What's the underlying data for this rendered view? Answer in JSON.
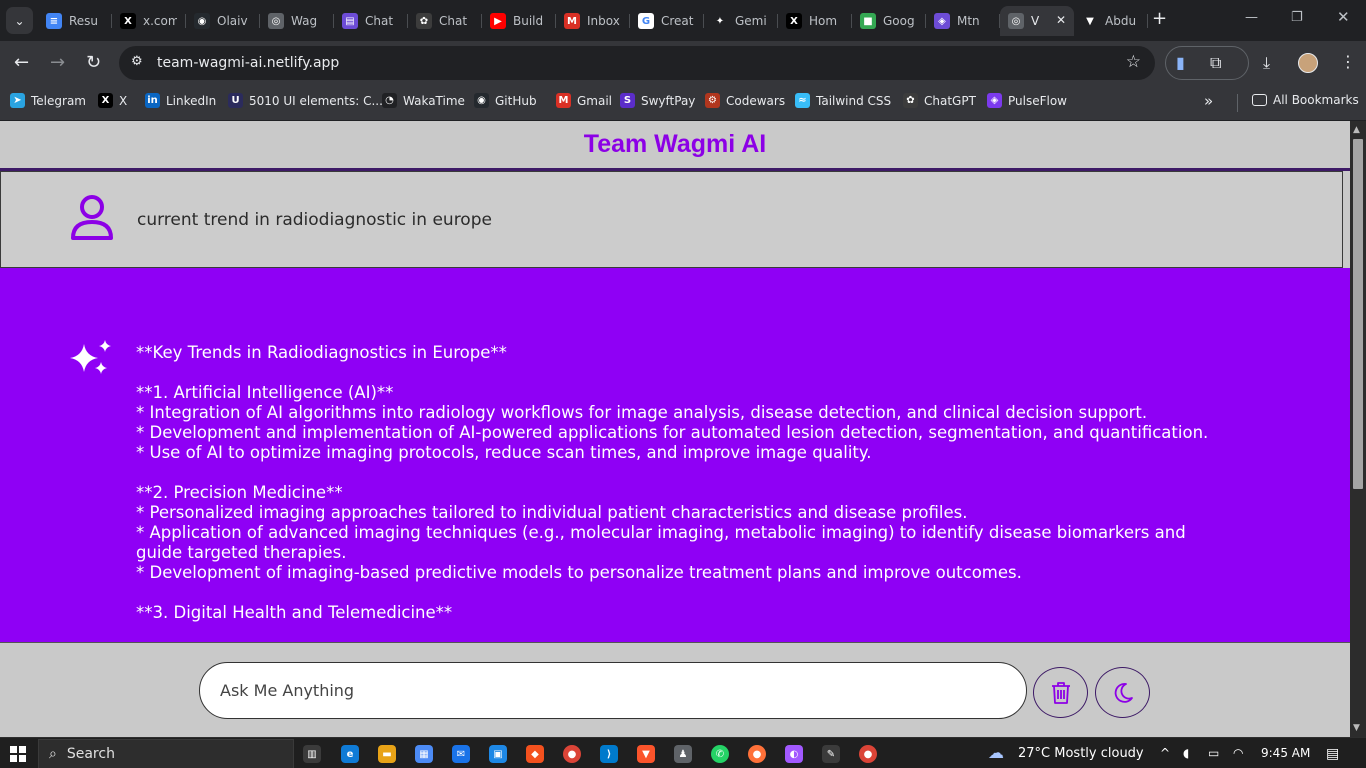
{
  "browser": {
    "tabs": [
      {
        "label": "Resu",
        "icon": "docs-icon",
        "color": "#4285f4",
        "glyph": "≡"
      },
      {
        "label": "x.com",
        "icon": "x-icon",
        "color": "#000000",
        "glyph": "X"
      },
      {
        "label": "Olaiv",
        "icon": "github-icon",
        "color": "#24292e",
        "glyph": "◉"
      },
      {
        "label": "Wag",
        "icon": "globe-icon",
        "color": "#5f6368",
        "glyph": "◎"
      },
      {
        "label": "Chat",
        "icon": "app-icon",
        "color": "#6d4cd6",
        "glyph": "▤"
      },
      {
        "label": "Chat",
        "icon": "chatgpt-icon",
        "color": "#3c3c3c",
        "glyph": "✿"
      },
      {
        "label": "Build",
        "icon": "youtube-icon",
        "color": "#ff0000",
        "glyph": "▶"
      },
      {
        "label": "Inbox",
        "icon": "gmail-icon",
        "color": "#d93025",
        "glyph": "M"
      },
      {
        "label": "Creat",
        "icon": "google-icon",
        "color": "#ffffff",
        "glyph": "G"
      },
      {
        "label": "Gemi",
        "icon": "gemini-icon",
        "color": "#202124",
        "glyph": "✦"
      },
      {
        "label": "Hom",
        "icon": "x-icon",
        "color": "#000000",
        "glyph": "X"
      },
      {
        "label": "Goog",
        "icon": "meet-icon",
        "color": "#34a853",
        "glyph": "■"
      },
      {
        "label": "Mtn",
        "icon": "app-icon",
        "color": "#6d4cd6",
        "glyph": "◈"
      },
      {
        "label": "V",
        "icon": "globe-icon",
        "color": "#5f6368",
        "glyph": "◎",
        "active": true
      },
      {
        "label": "Abdu",
        "icon": "vite-icon",
        "color": "#202124",
        "glyph": "▼"
      }
    ],
    "url": "team-wagmi-ai.netlify.app",
    "bookmarks": [
      {
        "label": "Telegram",
        "icon": "telegram-icon",
        "color": "#2aa3e0",
        "glyph": "➤"
      },
      {
        "label": "X",
        "icon": "x-icon",
        "color": "#000000",
        "glyph": "X"
      },
      {
        "label": "LinkedIn",
        "icon": "linkedin-icon",
        "color": "#0a66c2",
        "glyph": "in"
      },
      {
        "label": "5010 UI elements: C...",
        "icon": "uiverse-icon",
        "color": "#2b2b5c",
        "glyph": "U"
      },
      {
        "label": "WakaTime",
        "icon": "wakatime-icon",
        "color": "#202124",
        "glyph": "◔"
      },
      {
        "label": "GitHub",
        "icon": "github-icon",
        "color": "#24292e",
        "glyph": "◉"
      },
      {
        "label": "Gmail",
        "icon": "gmail-icon",
        "color": "#d93025",
        "glyph": "M"
      },
      {
        "label": "SwyftPay",
        "icon": "swyftpay-icon",
        "color": "#5b2dc9",
        "glyph": "S"
      },
      {
        "label": "Codewars",
        "icon": "codewars-icon",
        "color": "#b1361e",
        "glyph": "⚙"
      },
      {
        "label": "Tailwind CSS",
        "icon": "tailwind-icon",
        "color": "#38bdf8",
        "glyph": "≈"
      },
      {
        "label": "ChatGPT",
        "icon": "chatgpt-icon",
        "color": "#3c3c3c",
        "glyph": "✿"
      },
      {
        "label": "PulseFlow",
        "icon": "pulseflow-icon",
        "color": "#7c3aed",
        "glyph": "◈"
      }
    ],
    "all_bookmarks": "All Bookmarks"
  },
  "app": {
    "title": "Team Wagmi AI",
    "accent": "#8f00f5",
    "user_message": "current trend in radiodiagnostic in europe",
    "ai_lines": [
      "**Key Trends in Radiodiagnostics in Europe**",
      "",
      "**1. Artificial Intelligence (AI)**",
      "* Integration of AI algorithms into radiology workflows for image analysis, disease detection, and clinical decision support.",
      "* Development and implementation of AI-powered applications for automated lesion detection, segmentation, and quantification.",
      "* Use of AI to optimize imaging protocols, reduce scan times, and improve image quality.",
      "",
      "**2. Precision Medicine**",
      "* Personalized imaging approaches tailored to individual patient characteristics and disease profiles.",
      "* Application of advanced imaging techniques (e.g., molecular imaging, metabolic imaging) to identify disease biomarkers and guide targeted therapies.",
      "* Development of imaging-based predictive models to personalize treatment plans and improve outcomes.",
      "",
      "**3. Digital Health and Telemedicine**"
    ],
    "input_placeholder": "Ask Me Anything"
  },
  "taskbar": {
    "search": "Search",
    "weather": "27°C  Mostly cloudy",
    "time": "9:45 AM"
  }
}
